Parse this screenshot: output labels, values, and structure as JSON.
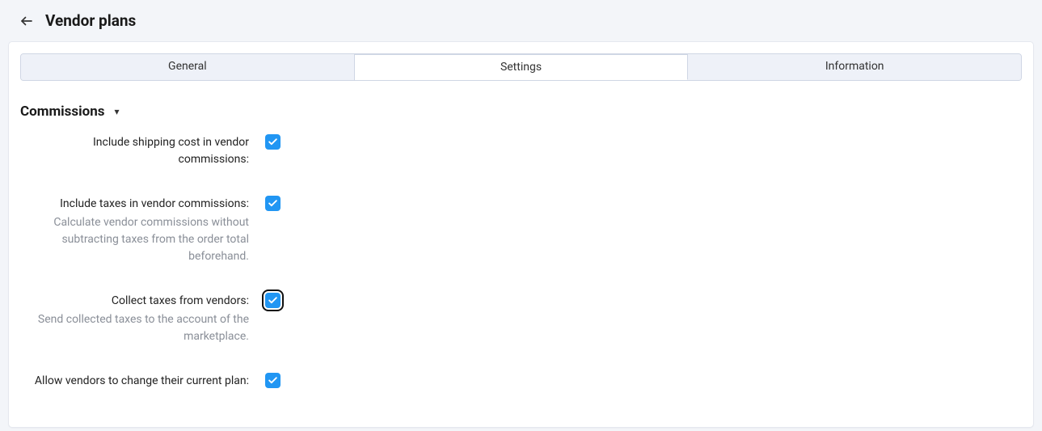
{
  "header": {
    "title": "Vendor plans"
  },
  "tabs": {
    "general": "General",
    "settings": "Settings",
    "information": "Information",
    "active": "settings"
  },
  "section": {
    "title": "Commissions"
  },
  "fields": {
    "include_shipping": {
      "label": "Include shipping cost in vendor commissions:",
      "checked": true
    },
    "include_taxes": {
      "label": "Include taxes in vendor commissions:",
      "help": "Calculate vendor commissions without subtracting taxes from the order total beforehand.",
      "checked": true
    },
    "collect_taxes": {
      "label": "Collect taxes from vendors:",
      "help": "Send collected taxes to the account of the marketplace.",
      "checked": true,
      "focused": true
    },
    "allow_change_plan": {
      "label": "Allow vendors to change their current plan:",
      "checked": true
    }
  }
}
